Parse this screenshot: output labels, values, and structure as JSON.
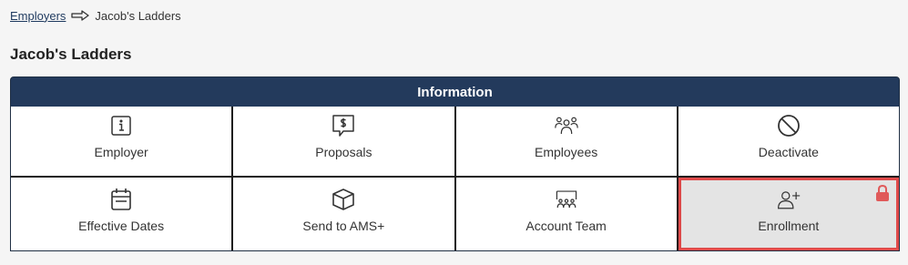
{
  "breadcrumb": {
    "parent": "Employers",
    "current": "Jacob's Ladders"
  },
  "page": {
    "title": "Jacob's Ladders"
  },
  "panel": {
    "header": "Information",
    "tiles": [
      {
        "label": "Employer",
        "icon": "info-icon"
      },
      {
        "label": "Proposals",
        "icon": "proposal-dollar-icon"
      },
      {
        "label": "Employees",
        "icon": "users-group-icon"
      },
      {
        "label": "Deactivate",
        "icon": "block-icon"
      },
      {
        "label": "Effective Dates",
        "icon": "calendar-icon"
      },
      {
        "label": "Send to AMS+",
        "icon": "box-icon"
      },
      {
        "label": "Account Team",
        "icon": "team-presentation-icon"
      },
      {
        "label": "Enrollment",
        "icon": "user-plus-icon",
        "locked": true
      }
    ]
  },
  "colors": {
    "header_bg": "#233a5c",
    "locked_outline": "#e04a4a",
    "lock_icon": "#e05a5a"
  }
}
